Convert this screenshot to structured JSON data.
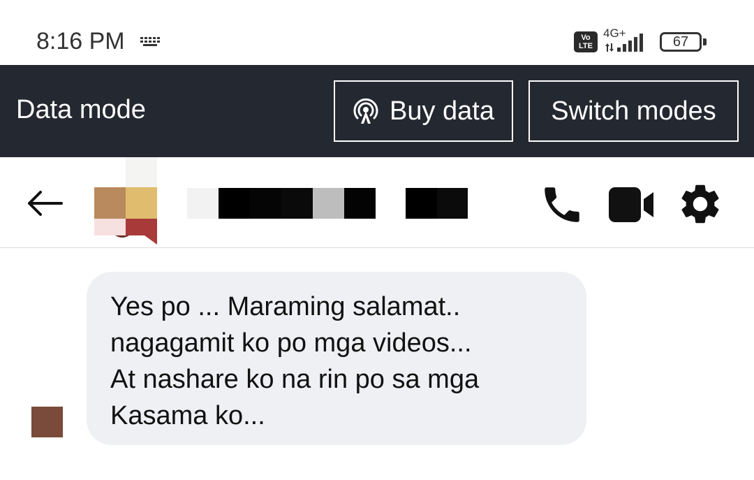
{
  "status_bar": {
    "time": "8:16 PM",
    "network": "4G+",
    "volte_line1": "Vo",
    "volte_line2": "LTE",
    "battery_level": "67"
  },
  "data_bar": {
    "mode_label": "Data mode",
    "buy_label": "Buy data",
    "switch_label": "Switch modes"
  },
  "header": {
    "icons": [
      "back-arrow-icon",
      "phone-icon",
      "video-camera-icon",
      "gear-icon"
    ]
  },
  "messages": [
    {
      "text": "Yes po ... Maraming salamat..\nnagagamit ko po mga videos...\nAt nashare ko na rin po sa mga\nKasama ko..."
    }
  ],
  "colors": {
    "data_bar_bg": "#242830",
    "bubble_bg": "#eff0f4",
    "icon_color": "#111111"
  }
}
